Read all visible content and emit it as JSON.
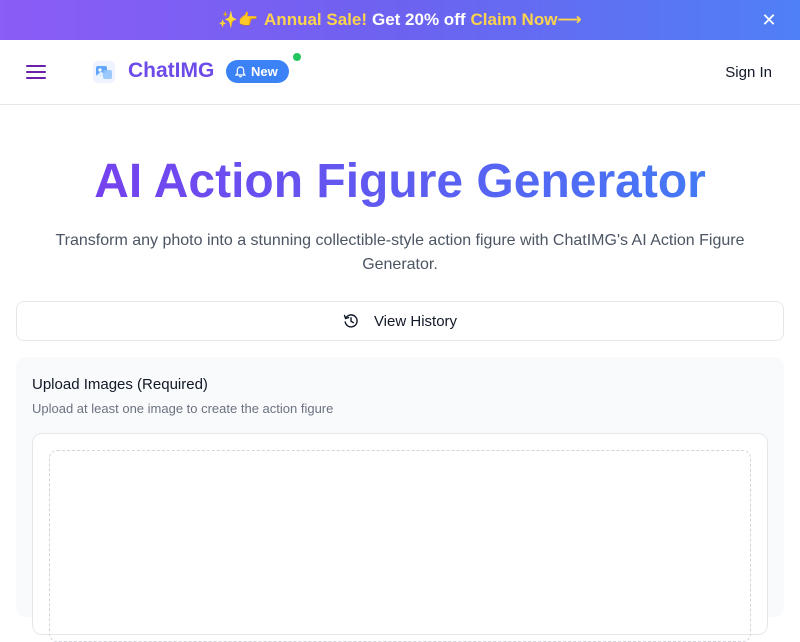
{
  "banner": {
    "emoji": "✨👉",
    "annual_sale": "Annual Sale!",
    "offer": "Get 20% off",
    "claim": "Claim Now⟶",
    "close_icon": "close-icon"
  },
  "header": {
    "brand": "ChatIMG",
    "new_badge": "New",
    "sign_in": "Sign In"
  },
  "hero": {
    "title": "AI Action Figure Generator",
    "subtitle": "Transform any photo into a stunning collectible-style action figure with ChatIMG's AI Action Figure Generator."
  },
  "history": {
    "label": "View History"
  },
  "upload": {
    "title": "Upload Images (Required)",
    "description": "Upload at least one image to create the action figure"
  },
  "colors": {
    "brand": "#6d4be8",
    "badge": "#3b82f6",
    "online_dot": "#22c55e",
    "banner_highlight": "#fcd34d"
  }
}
